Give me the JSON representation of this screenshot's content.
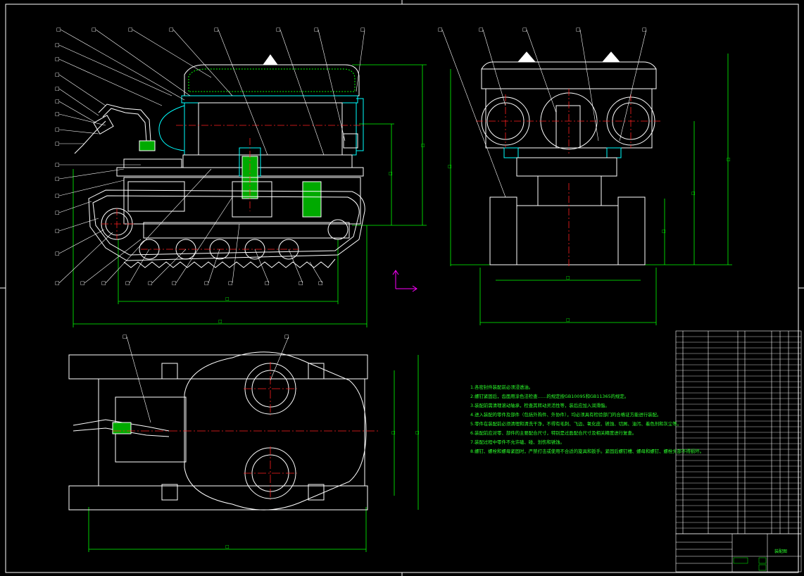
{
  "drawing": {
    "balloon_label": "□",
    "dimension_label": "□",
    "colors": {
      "background": "#000000",
      "line": "#ffffff",
      "dimension": "#00ff00",
      "centerline": "#ff2020",
      "hidden": "#00ffff",
      "ucs": "#ff00ff",
      "hatch": "#00ff00"
    }
  },
  "technical_requirements": [
    "1.各密封件装配前必须浸透油。",
    "2.螺钉紧固后，齿面用涂色法检查……的规定按GB10095和GB11365的规定。",
    "3.装配前需清理滚动轴承，检查其转动灵活性等，装后应加入润滑脂。",
    "4.进入装配的零件及部件（包括外购件、外协件），均必须具有检验部门的合格证方能进行装配。",
    "5.零件在装配前必须清理和清洗干净，不得有毛刺、飞边、氧化皮、锈蚀、切屑、油污、着色剂和灰尘等。",
    "6.装配前应对零、部件的主要配合尺寸，特别是过盈配合尺寸及相关精度进行复查。",
    "7.装配过程中零件不允许磕、碰、划伤和锈蚀。",
    "8.螺钉、螺栓和螺母紧固时，严禁打击或使用不合适的旋具和扳手。紧固后螺钉槽、螺母和螺钉、螺栓头部不得损坏。"
  ],
  "title_block": {
    "title": "装配图"
  }
}
